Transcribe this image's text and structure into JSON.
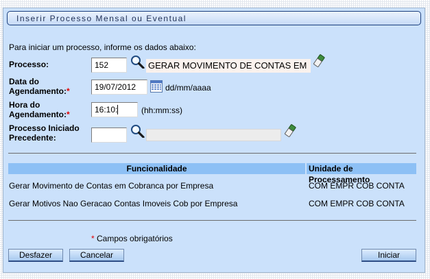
{
  "window": {
    "title": "Inserir Processo Mensal ou Eventual"
  },
  "form": {
    "instructions": "Para iniciar um processo, informe os dados abaixo:",
    "processo": {
      "label": "Processo:",
      "value": "152",
      "description": "GERAR MOVIMENTO DE CONTAS EM"
    },
    "data_agendamento": {
      "label_line1": "Data do",
      "label_line2": "Agendamento:",
      "required_mark": "*",
      "value": "19/07/2012",
      "format_hint": "dd/mm/aaaa"
    },
    "hora_agendamento": {
      "label_line1": "Hora do",
      "label_line2": "Agendamento:",
      "required_mark": "*",
      "value": "16:10:",
      "format_hint": "(hh:mm:ss)"
    },
    "processo_precedente": {
      "label_line1": "Processo Iniciado",
      "label_line2": "Precedente:",
      "value": "",
      "description": ""
    }
  },
  "table": {
    "columns": [
      "Funcionalidade",
      "Unidade de Processamento"
    ],
    "rows": [
      {
        "funcionalidade": "Gerar Movimento de Contas em Cobranca por Empresa",
        "unidade": "COM EMPR COB CONTA"
      },
      {
        "funcionalidade": "Gerar Motivos Nao Geracao Contas Imoveis Cob por Empresa",
        "unidade": "COM EMPR COB CONTA"
      }
    ]
  },
  "footer": {
    "required_mark": "*",
    "required_note": "Campos obrigatórios"
  },
  "buttons": {
    "desfazer": "Desfazer",
    "cancelar": "Cancelar",
    "iniciar": "Iniciar"
  },
  "icons": {
    "lookup": "magnifier-icon",
    "clear": "eraser-icon",
    "calendar": "calendar-icon"
  },
  "colors": {
    "panel_background": "#cbe1fb",
    "table_header": "#8dc0f5",
    "required": "#e00000",
    "button_border": "#2d4d86"
  }
}
